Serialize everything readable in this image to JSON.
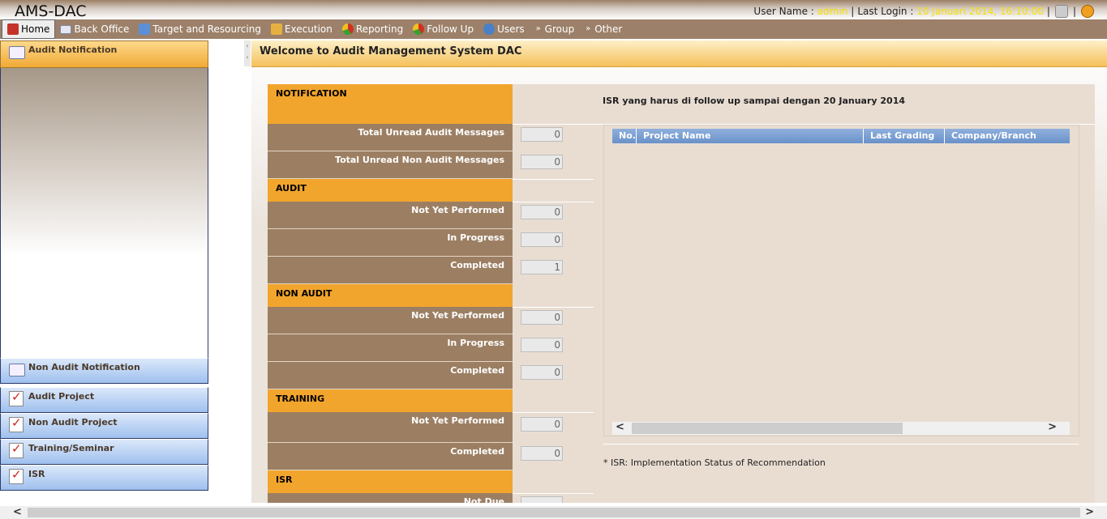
{
  "app": {
    "title": "AMS-DAC"
  },
  "user": {
    "name_label": "User Name :",
    "name": "admin",
    "separator": "|",
    "last_login_label": "Last Login :",
    "last_login": "10 Januari 2014, 16:10:00"
  },
  "menu": [
    {
      "label": "Home",
      "icon": "home-icon"
    },
    {
      "label": "Back Office",
      "icon": "mail-icon"
    },
    {
      "label": "Target and Resourcing",
      "icon": "target-icon"
    },
    {
      "label": "Execution",
      "icon": "execution-icon"
    },
    {
      "label": "Reporting",
      "icon": "pie-chart-icon"
    },
    {
      "label": "Follow Up",
      "icon": "pie-chart-icon"
    },
    {
      "label": "Users",
      "icon": "users-icon"
    },
    {
      "label": "Group",
      "icon": "chevrons-right-icon"
    },
    {
      "label": "Other",
      "icon": "chevrons-right-icon"
    }
  ],
  "sidebar": {
    "active": {
      "label": "Audit Notification",
      "icon": "envelope-icon"
    },
    "items": [
      {
        "label": "Non Audit Notification",
        "icon": "envelope-icon"
      },
      {
        "label": "Audit Project",
        "icon": "checklist-icon"
      },
      {
        "label": "Non Audit Project",
        "icon": "checklist-icon"
      },
      {
        "label": "Training/Seminar",
        "icon": "checklist-icon"
      },
      {
        "label": "ISR",
        "icon": "checklist-icon"
      }
    ]
  },
  "main": {
    "welcome": "Welcome to Audit Management System DAC",
    "sections": {
      "notification": "NOTIFICATION",
      "audit": "AUDIT",
      "non_audit": "NON AUDIT",
      "training": "TRAINING",
      "isr": "ISR"
    },
    "rows": {
      "unread_audit": {
        "label": "Total Unread Audit Messages",
        "value": "0"
      },
      "unread_non_audit": {
        "label": "Total Unread Non Audit Messages",
        "value": "0"
      },
      "audit_not_yet": {
        "label": "Not Yet Performed",
        "value": "0"
      },
      "audit_in_progress": {
        "label": "In Progress",
        "value": "0"
      },
      "audit_completed": {
        "label": "Completed",
        "value": "1"
      },
      "nonaudit_not_yet": {
        "label": "Not Yet Performed",
        "value": "0"
      },
      "nonaudit_in_progress": {
        "label": "In Progress",
        "value": "0"
      },
      "nonaudit_completed": {
        "label": "Completed",
        "value": "0"
      },
      "training_not_yet": {
        "label": "Not Yet Performed",
        "value": "0"
      },
      "training_completed": {
        "label": "Completed",
        "value": "0"
      },
      "isr_not_due": {
        "label": "Not Due",
        "value": ""
      }
    },
    "isr": {
      "title": "ISR yang harus di follow up sampai dengan 20 January 2014",
      "columns": [
        "No.",
        "Project Name",
        "Last Grading",
        "Company/Branch"
      ],
      "note": "* ISR: Implementation Status of Recommendation"
    }
  },
  "colors": {
    "menubar": "#9c8069",
    "section_header": "#f2a52d",
    "row_bg": "#9c7f63",
    "table_header": "#6a91c9",
    "accent_text": "#f5e000"
  }
}
